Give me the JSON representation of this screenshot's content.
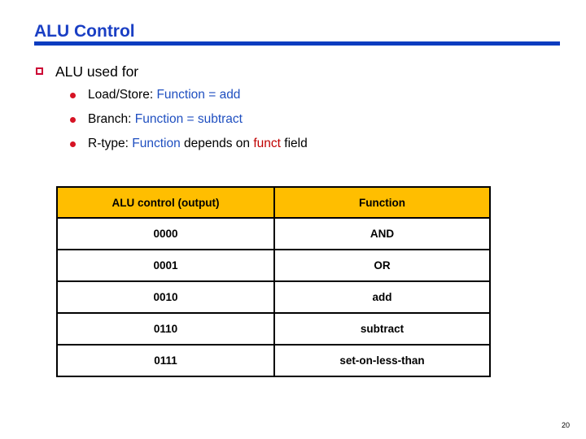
{
  "slide": {
    "title": "ALU Control",
    "page_number": "20",
    "colors": {
      "title_blue": "#1a3fc4",
      "rule_blue": "#0a3cc0",
      "accent_blue": "#1f4fc0",
      "accent_red": "#c00000",
      "bullet_red": "#d61324",
      "lvl1_marker_red": "#cc0033",
      "table_header_orange": "#ffbe00",
      "table_border": "#000000"
    }
  },
  "body": {
    "level1": {
      "marker": "hollow-square-bullet",
      "text": "ALU used for"
    },
    "level2": [
      {
        "marker": "round-bullet",
        "parts": [
          {
            "text": "Load/Store: ",
            "color": "blk"
          },
          {
            "text": "Function = add",
            "color": "blue"
          }
        ]
      },
      {
        "marker": "round-bullet",
        "parts": [
          {
            "text": "Branch: ",
            "color": "blk"
          },
          {
            "text": "Function = subtract",
            "color": "blue"
          }
        ]
      },
      {
        "marker": "round-bullet",
        "parts": [
          {
            "text": "R-type: ",
            "color": "blk"
          },
          {
            "text": "Function ",
            "color": "blue"
          },
          {
            "text": "depends on ",
            "color": "blk"
          },
          {
            "text": "funct",
            "color": "red"
          },
          {
            "text": " field",
            "color": "blk"
          }
        ]
      }
    ]
  },
  "table": {
    "headers": [
      "ALU control (output)",
      "Function"
    ],
    "rows": [
      [
        "0000",
        "AND"
      ],
      [
        "0001",
        "OR"
      ],
      [
        "0010",
        "add"
      ],
      [
        "0110",
        "subtract"
      ],
      [
        "0111",
        "set-on-less-than"
      ]
    ]
  }
}
